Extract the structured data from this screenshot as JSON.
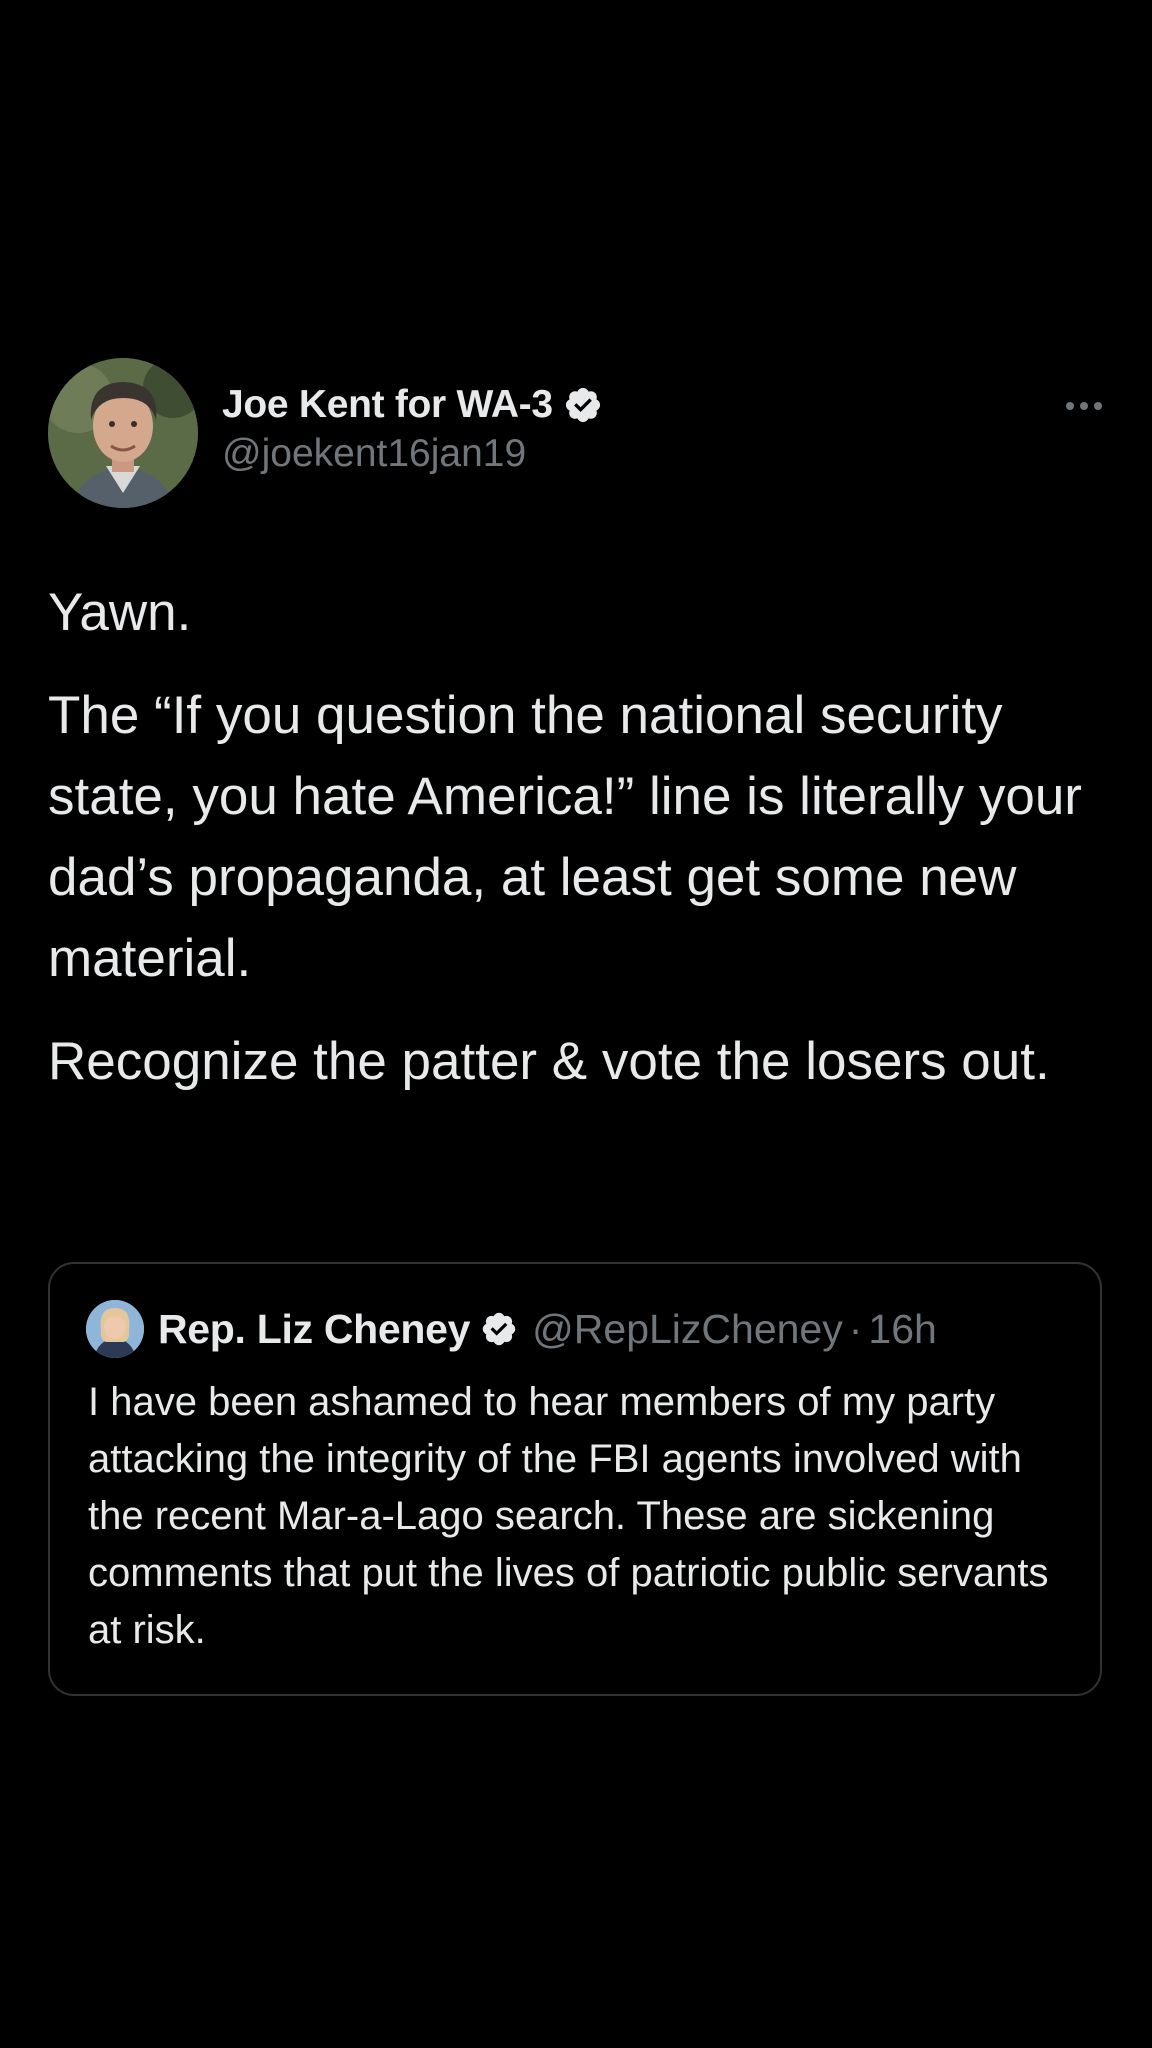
{
  "tweet": {
    "author": {
      "display_name": "Joe Kent for WA-3",
      "handle": "@joekent16jan19",
      "verified": true
    },
    "paragraphs": [
      "Yawn.",
      "The “If you question the national security state, you hate America!” line is literally your dad’s propaganda, at least get some new material.",
      "Recognize the patter & vote the losers out."
    ]
  },
  "quoted_tweet": {
    "author": {
      "display_name": "Rep. Liz Cheney",
      "handle": "@RepLizCheney",
      "verified": true
    },
    "separator": "·",
    "time": "16h",
    "text": "I have been ashamed to hear members of my party attacking the integrity of the FBI agents involved with the recent Mar-a-Lago search. These are sickening comments that put the lives of patriotic public servants at risk."
  },
  "icons": {
    "verified": "verified-badge-icon",
    "more": "more-options-icon"
  },
  "colors": {
    "background": "#000000",
    "text": "#e7e9ea",
    "secondary": "#71767b",
    "border": "#2f3336"
  }
}
